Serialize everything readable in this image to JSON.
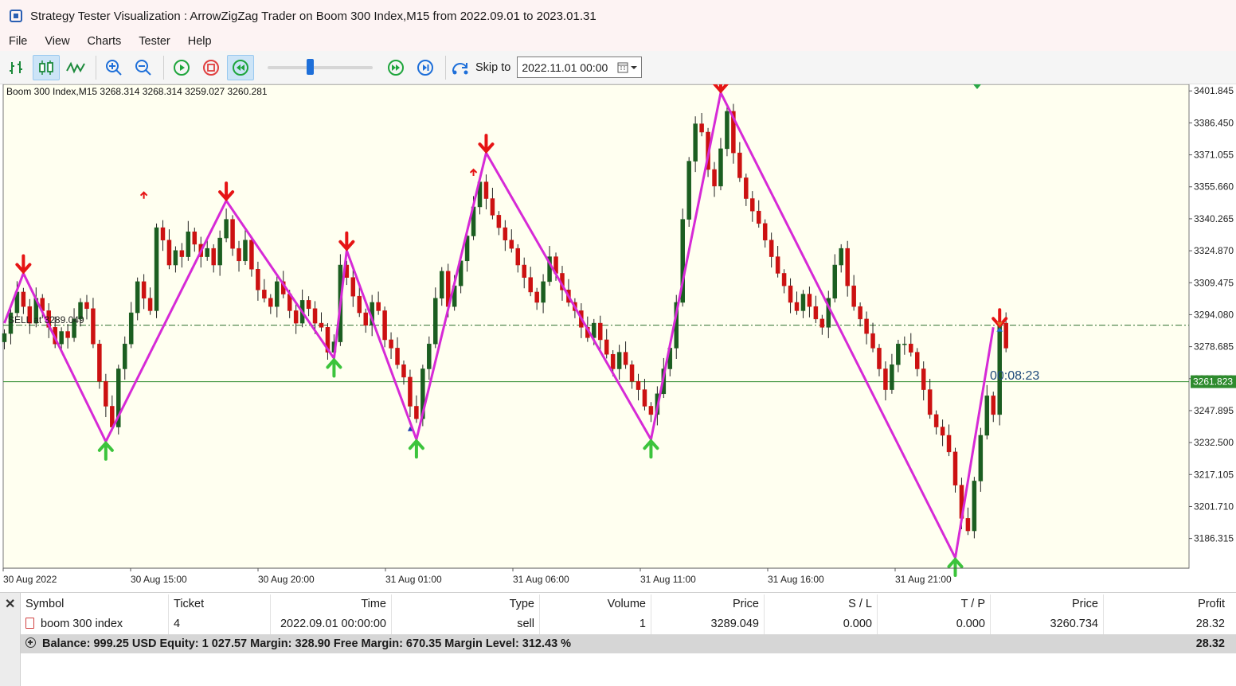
{
  "window": {
    "title": "Strategy Tester Visualization : ArrowZigZag Trader on Boom 300 Index,M15 from 2022.09.01 to 2023.01.31"
  },
  "menu": [
    "File",
    "View",
    "Charts",
    "Tester",
    "Help"
  ],
  "toolbar": {
    "skip_label": "Skip to",
    "skip_date": "2022.11.01 00:00",
    "speed_fraction": 0.4
  },
  "chart": {
    "info_line": "Boom 300 Index,M15  3268.314 3268.314 3259.027 3260.281",
    "order_line_label": "SELL  at 3289.049",
    "countdown": "00:08:23",
    "current_price_label": "3261.823",
    "colors": {
      "background": "#fffff0",
      "bull": "#1b5e20",
      "bear": "#cc1111",
      "zigzag": "#d62ad6",
      "arrow_up": "#3cc43c",
      "arrow_down": "#e61414",
      "bid_line": "#2e8b2e"
    }
  },
  "chart_data": {
    "type": "candlestick",
    "title": "Boom 300 Index,M15",
    "y_ticks": [
      3401.845,
      3386.45,
      3371.055,
      3355.66,
      3340.265,
      3324.87,
      3309.475,
      3294.08,
      3278.685,
      3263.29,
      3247.895,
      3232.5,
      3217.105,
      3201.71,
      3186.315
    ],
    "y_range": [
      3172,
      3405
    ],
    "x_ticks": [
      "30 Aug 2022",
      "30 Aug 15:00",
      "30 Aug 20:00",
      "31 Aug 01:00",
      "31 Aug 06:00",
      "31 Aug 11:00",
      "31 Aug 16:00",
      "31 Aug 21:00"
    ],
    "bar_count": 153,
    "order_price": 3289.049,
    "bid_price": 3261.823,
    "zigzag": [
      {
        "bar": 0,
        "price": 3290
      },
      {
        "bar": 3,
        "price": 3314
      },
      {
        "bar": 16,
        "price": 3233
      },
      {
        "bar": 35,
        "price": 3349
      },
      {
        "bar": 52,
        "price": 3273
      },
      {
        "bar": 54,
        "price": 3325
      },
      {
        "bar": 65,
        "price": 3234
      },
      {
        "bar": 76,
        "price": 3372
      },
      {
        "bar": 102,
        "price": 3234
      },
      {
        "bar": 113,
        "price": 3401
      },
      {
        "bar": 150,
        "price": 3177
      },
      {
        "bar": 156,
        "price": 3288
      }
    ],
    "down_arrows": [
      {
        "bar": 3,
        "price": 3314
      },
      {
        "bar": 35,
        "price": 3349
      },
      {
        "bar": 54,
        "price": 3325
      },
      {
        "bar": 76,
        "price": 3372
      },
      {
        "bar": 113,
        "price": 3401
      },
      {
        "bar": 157,
        "price": 3288
      }
    ],
    "up_arrows": [
      {
        "bar": 16,
        "price": 3233
      },
      {
        "bar": 52,
        "price": 3273
      },
      {
        "bar": 65,
        "price": 3234
      },
      {
        "bar": 102,
        "price": 3234
      },
      {
        "bar": 150,
        "price": 3177
      }
    ],
    "small_up_arrows": [
      {
        "bar": 22,
        "price": 3353
      },
      {
        "bar": 74,
        "price": 3364
      }
    ],
    "closes": [
      3285,
      3295,
      3305,
      3298,
      3290,
      3302,
      3296,
      3288,
      3280,
      3286,
      3283,
      3292,
      3300,
      3297,
      3280,
      3262,
      3250,
      3240,
      3268,
      3280,
      3295,
      3310,
      3302,
      3296,
      3336,
      3330,
      3318,
      3325,
      3322,
      3334,
      3328,
      3322,
      3326,
      3318,
      3331,
      3340,
      3326,
      3320,
      3330,
      3316,
      3306,
      3302,
      3298,
      3310,
      3304,
      3296,
      3290,
      3301,
      3297,
      3290,
      3288,
      3276,
      3281,
      3318,
      3312,
      3303,
      3295,
      3289,
      3300,
      3296,
      3282,
      3278,
      3270,
      3264,
      3250,
      3244,
      3268,
      3280,
      3302,
      3315,
      3298,
      3308,
      3320,
      3332,
      3346,
      3358,
      3350,
      3342,
      3336,
      3330,
      3326,
      3318,
      3312,
      3305,
      3300,
      3310,
      3322,
      3314,
      3306,
      3300,
      3296,
      3288,
      3283,
      3290,
      3282,
      3275,
      3268,
      3276,
      3270,
      3262,
      3258,
      3250,
      3246,
      3256,
      3268,
      3278,
      3300,
      3340,
      3368,
      3386,
      3382,
      3364,
      3356,
      3374,
      3392,
      3372,
      3360,
      3350,
      3344,
      3338,
      3330,
      3322,
      3314,
      3308,
      3300,
      3296,
      3304,
      3298,
      3292,
      3288,
      3302,
      3318,
      3326,
      3308,
      3298,
      3292,
      3285,
      3278,
      3268,
      3258,
      3270,
      3280,
      3280,
      3276,
      3268,
      3258,
      3246,
      3240,
      3236,
      3228,
      3212,
      3196,
      3190,
      3214,
      3236,
      3255,
      3246,
      3290,
      3278
    ]
  },
  "terminal": {
    "headers": {
      "symbol": "Symbol",
      "ticket": "Ticket",
      "time": "Time",
      "type": "Type",
      "volume": "Volume",
      "price": "Price",
      "sl": "S / L",
      "tp": "T / P",
      "price2": "Price",
      "profit": "Profit"
    },
    "order": {
      "symbol": "boom 300 index",
      "ticket": "4",
      "time": "2022.09.01 00:00:00",
      "type": "sell",
      "volume": "1",
      "price": "3289.049",
      "sl": "0.000",
      "tp": "0.000",
      "price2": "3260.734",
      "profit": "28.32"
    },
    "summary": "Balance: 999.25 USD  Equity: 1 027.57  Margin: 328.90  Free Margin: 670.35  Margin Level: 312.43 %",
    "summary_profit": "28.32"
  }
}
